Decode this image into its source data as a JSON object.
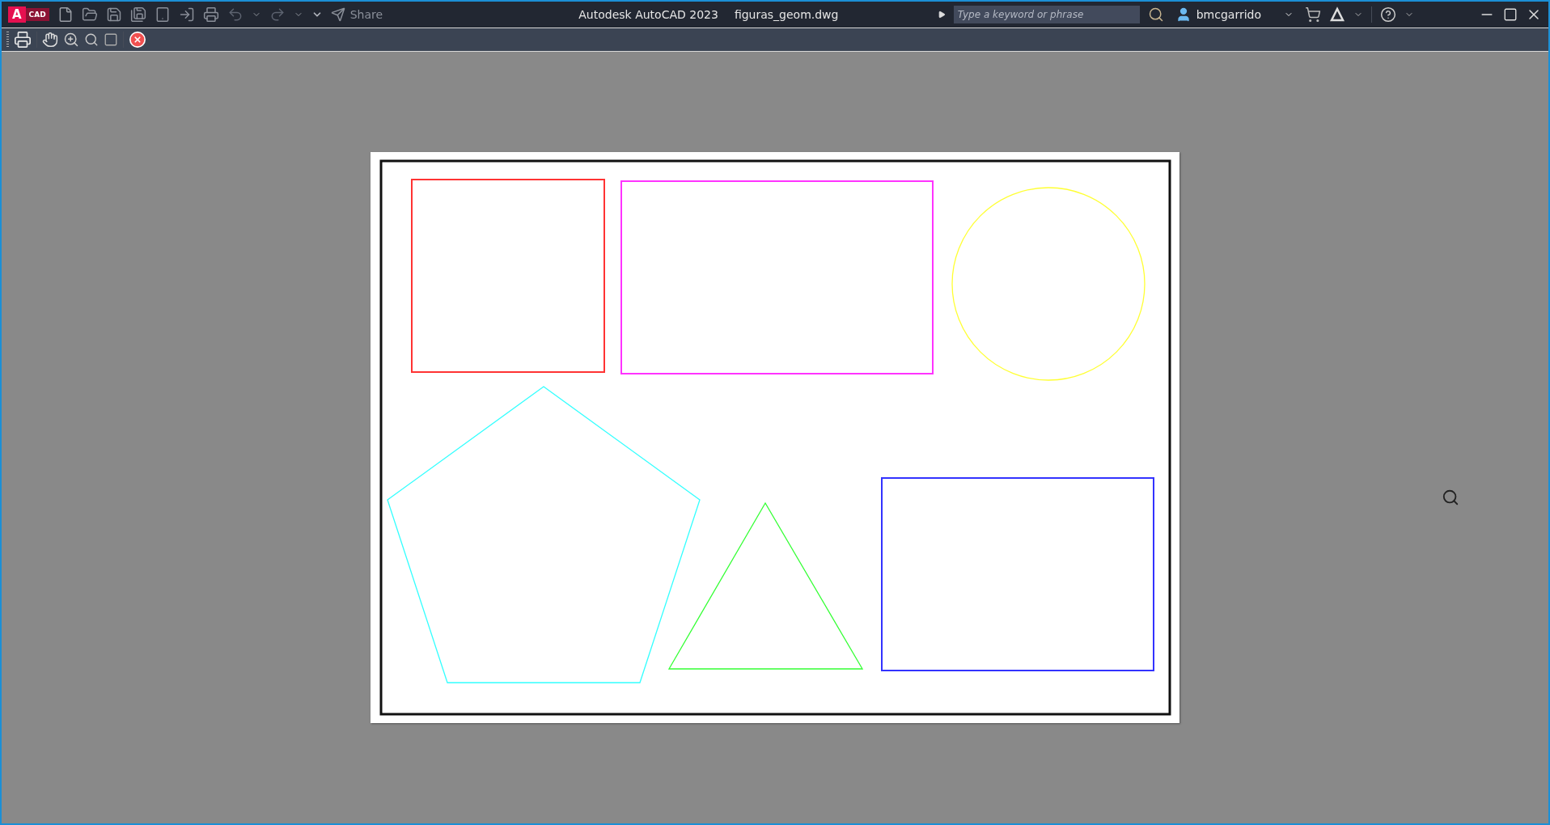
{
  "title_bar": {
    "logo_letter": "A",
    "logo_text": "CAD",
    "share": "Share",
    "app_title": "Autodesk AutoCAD 2023",
    "file_name": "figuras_geom.dwg",
    "search": {
      "placeholder": "Type a keyword or phrase"
    },
    "user": "bmcgarrido"
  },
  "drawing": {
    "shapes": [
      {
        "kind": "rect",
        "color": "#ff3333"
      },
      {
        "kind": "rect",
        "color": "#ff33ff"
      },
      {
        "kind": "circle",
        "color": "#ffff33"
      },
      {
        "kind": "polygon",
        "color": "#33ffff"
      },
      {
        "kind": "polygon",
        "color": "#33ff33"
      },
      {
        "kind": "rect",
        "color": "#3333ff"
      }
    ]
  }
}
